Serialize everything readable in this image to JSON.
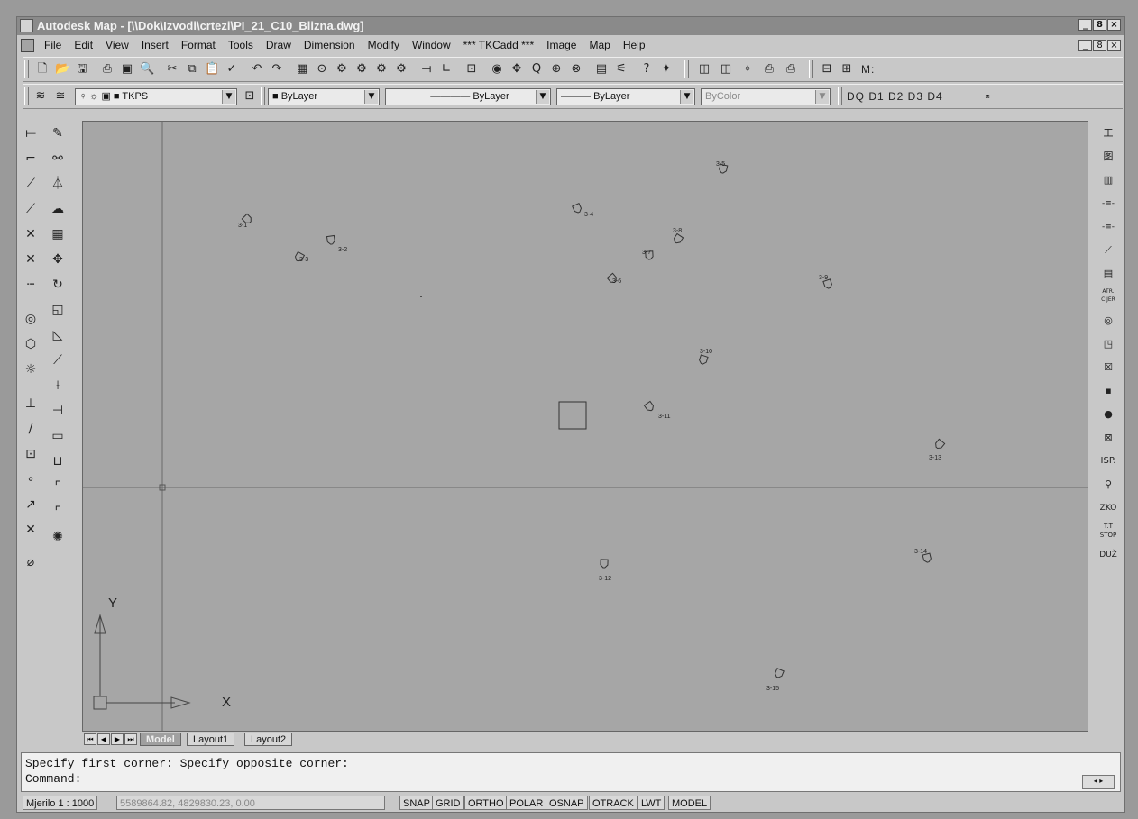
{
  "window": {
    "title": "Autodesk Map - [\\\\Dok\\Izvodi\\crtezi\\PI_21_C10_Blizna.dwg]",
    "controls": [
      "_",
      "8",
      "×"
    ]
  },
  "menu": [
    "File",
    "Edit",
    "View",
    "Insert",
    "Format",
    "Tools",
    "Draw",
    "Dimension",
    "Modify",
    "Window",
    "*** TKCadd ***",
    "Image",
    "Map",
    "Help"
  ],
  "toolbar": {
    "layer_name": "TKPS",
    "color": "ByLayer",
    "linetype": "ByLayer",
    "lineweight": "ByLayer",
    "plotstyle": "ByColor",
    "d_buttons": "DQ D1 D2 D3 D4",
    "right_label": "M:"
  },
  "drawing": {
    "points": [
      {
        "label": "3-1"
      },
      {
        "label": "3-2"
      },
      {
        "label": "3-3"
      },
      {
        "label": "3-4"
      },
      {
        "label": "3-5"
      },
      {
        "label": "3-6"
      },
      {
        "label": "3-7"
      },
      {
        "label": "3-8"
      },
      {
        "label": "3-9"
      },
      {
        "label": "3-10"
      },
      {
        "label": "3-11"
      },
      {
        "label": "3-12"
      },
      {
        "label": "3-13"
      },
      {
        "label": "3-14"
      },
      {
        "label": "3-15"
      }
    ],
    "ucs_x": "X",
    "ucs_y": "Y"
  },
  "right_toolbar": [
    "工",
    "图",
    "▥",
    "-≡-",
    "-≡-",
    "⟋",
    "▤",
    "ATR. CIJER",
    "◎",
    "◳",
    "☒",
    "▪",
    "●",
    "⊠",
    "ISP.",
    "⚲",
    "ZKO",
    "T.T STOP",
    "DUŽ"
  ],
  "layout_tabs": [
    "Model",
    "Layout1",
    "Layout2"
  ],
  "command": {
    "line1": "Specify first corner: Specify opposite corner:",
    "line2": "Command:"
  },
  "status": {
    "scale": "Mjerilo  1 : 1000",
    "coords": "5589864.82, 4829830.23, 0.00",
    "toggles": [
      "SNAP",
      "GRID",
      "ORTHO",
      "POLAR",
      "OSNAP",
      "OTRACK",
      "LWT",
      "MODEL"
    ]
  }
}
